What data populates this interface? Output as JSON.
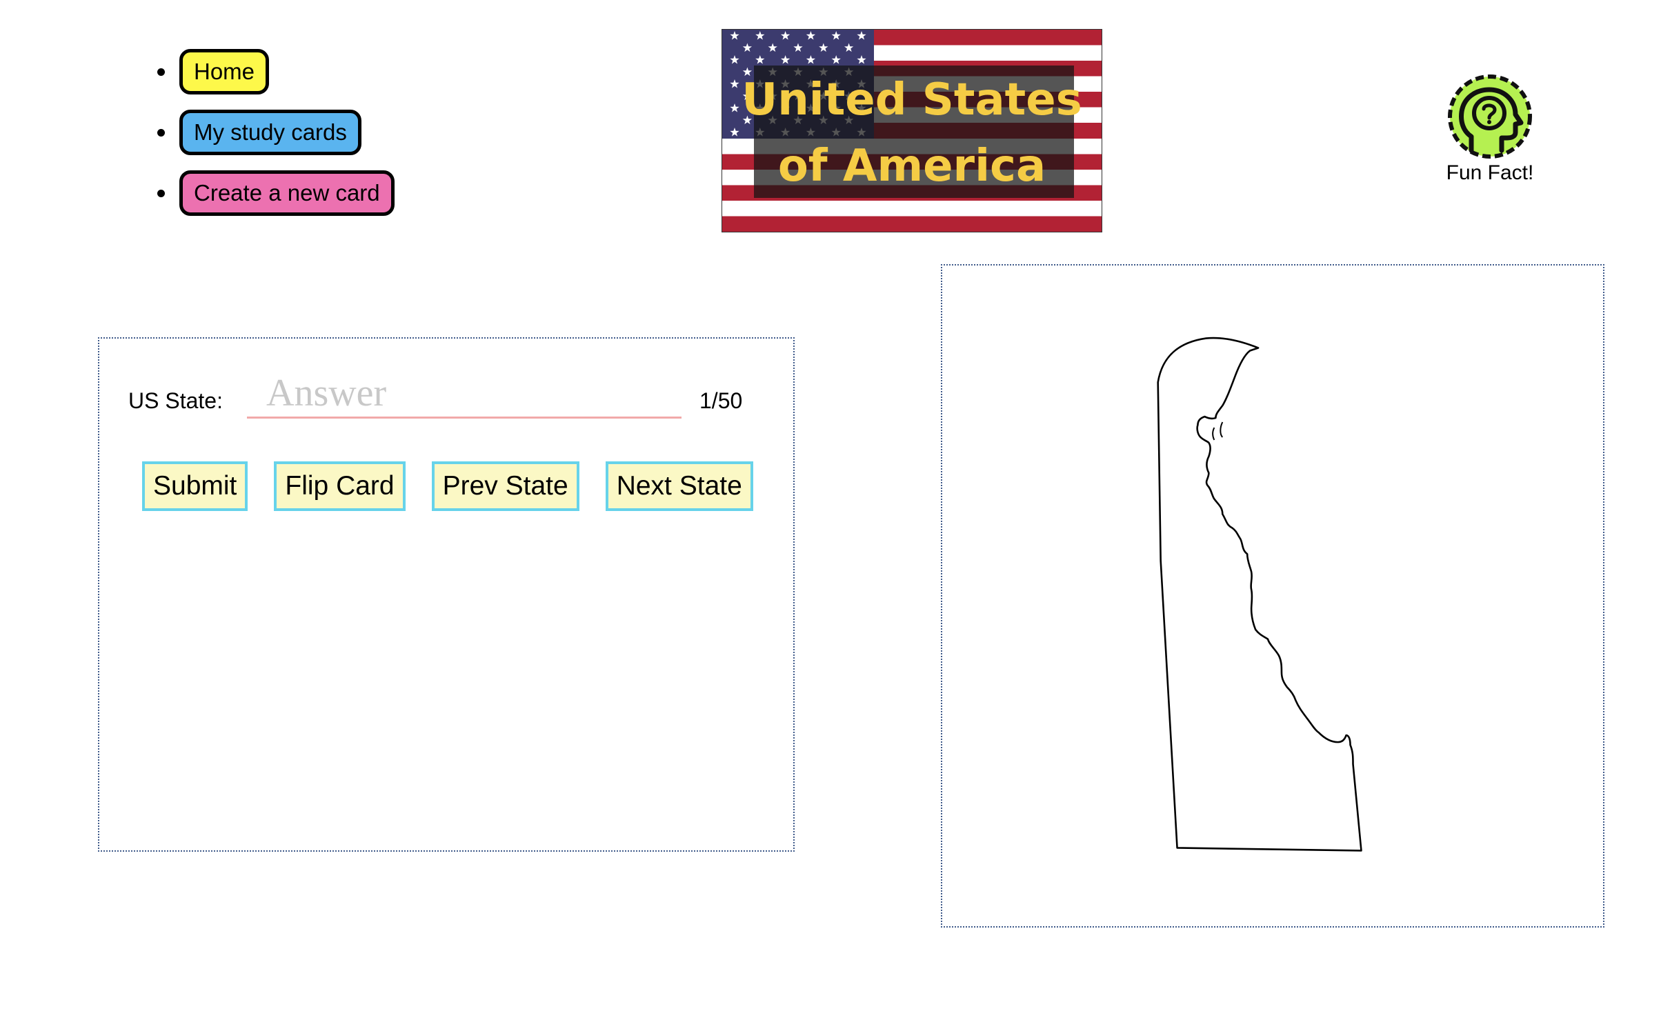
{
  "nav": {
    "items": [
      {
        "label": "Home",
        "color": "#fdf84a"
      },
      {
        "label": "My study cards",
        "color": "#5ab4ef"
      },
      {
        "label": "Create a new card",
        "color": "#ec71b0"
      }
    ]
  },
  "banner": {
    "title_line1": "United States",
    "title_line2": "of America",
    "title_color": "#f5cc45",
    "flag_red": "#b22234",
    "flag_blue": "#3c3b6e"
  },
  "fun_fact": {
    "label": "Fun Fact!",
    "icon": "question-head-icon",
    "icon_color": "#b5f051"
  },
  "card": {
    "field_label": "US State:",
    "answer_placeholder": "Answer",
    "answer_value": "",
    "counter": "1/50",
    "buttons": {
      "submit": "Submit",
      "flip": "Flip Card",
      "prev": "Prev State",
      "next": "Next State"
    },
    "button_bg": "#fbf8c5",
    "button_border": "#67d3ea"
  },
  "map": {
    "shape": "state-outline-icon"
  }
}
